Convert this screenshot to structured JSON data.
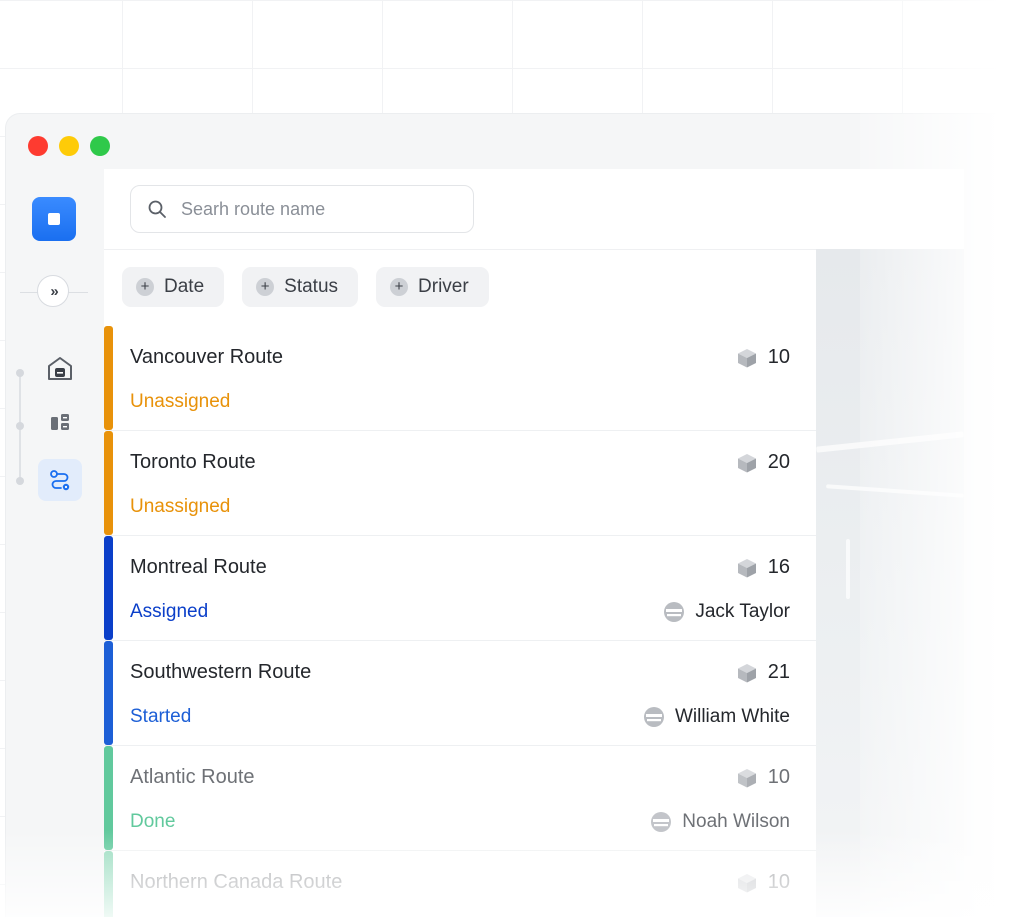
{
  "window": {
    "controls": [
      "close",
      "minimize",
      "maximize"
    ]
  },
  "sidebar": {
    "logo_icon": "app-logo-icon",
    "expand_icon": "double-chevron-right-icon",
    "expand_glyph": "»",
    "items": [
      {
        "icon": "warehouse-icon",
        "active": false
      },
      {
        "icon": "inventory-icon",
        "active": false
      },
      {
        "icon": "route-icon",
        "active": true
      }
    ]
  },
  "search": {
    "placeholder": "Searh route name",
    "value": ""
  },
  "filters": [
    {
      "label": "Date"
    },
    {
      "label": "Status"
    },
    {
      "label": "Driver"
    }
  ],
  "colors": {
    "unassigned": "#e8920a",
    "assigned": "#0b3fc9",
    "started": "#1d5fd6",
    "done": "#46c08c",
    "accent": "#1a6ff0"
  },
  "routes": [
    {
      "name": "Vancouver Route",
      "status": "Unassigned",
      "count": "10",
      "driver": ""
    },
    {
      "name": "Toronto Route",
      "status": "Unassigned",
      "count": "20",
      "driver": ""
    },
    {
      "name": "Montreal Route",
      "status": "Assigned",
      "count": "16",
      "driver": "Jack Taylor"
    },
    {
      "name": "Southwestern Route",
      "status": "Started",
      "count": "21",
      "driver": "William White"
    },
    {
      "name": "Atlantic Route",
      "status": "Done",
      "count": "10",
      "driver": "Noah Wilson"
    },
    {
      "name": "Northern Canada Route",
      "status": "",
      "count": "10",
      "driver": ""
    }
  ]
}
